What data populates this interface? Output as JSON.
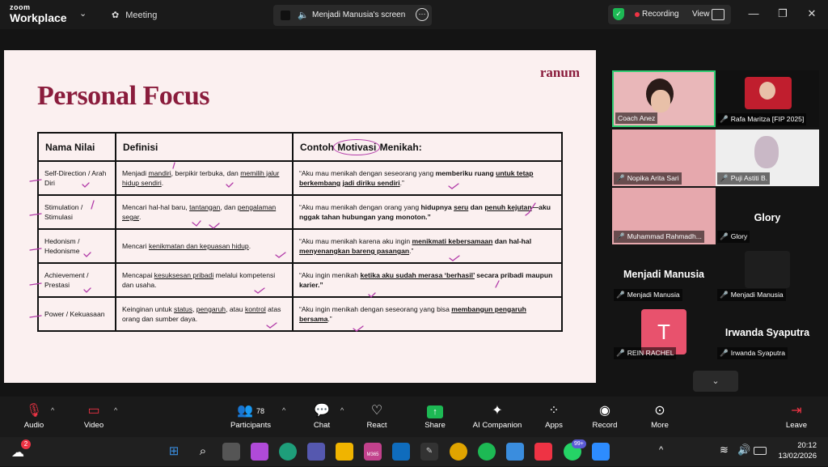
{
  "app": {
    "brand_top": "zoom",
    "brand_main": "Workplace",
    "meeting_label": "Meeting",
    "screen_label": "Menjadi Manusia's screen",
    "recording_label": "Recording",
    "view_label": "View"
  },
  "slide": {
    "logo": "ranum",
    "title": "Personal Focus",
    "headers": [
      "Nama Nilai",
      "Definisi",
      "Contoh ",
      "Motivasi",
      " Menikah:"
    ],
    "rows": [
      {
        "name": "Self-Direction / Arah Diri",
        "def": [
          "Menjadi ",
          "mandiri",
          ", berpikir terbuka, dan ",
          "memilih jalur hidup sendiri",
          "."
        ],
        "ex": [
          "“Aku mau menikah dengan seseorang yang ",
          "memberiku ruang",
          " ",
          "untuk tetap berkembang",
          " ",
          "jadi diriku sendiri",
          ".”"
        ]
      },
      {
        "name": "Stimulation / Stimulasi",
        "def": [
          "Mencari hal-hal baru, ",
          "tantangan",
          ", dan ",
          "pengalaman segar",
          "."
        ],
        "ex": [
          "“Aku mau menikah dengan orang yang ",
          "hidupnya",
          " ",
          "seru",
          " dan ",
          "penuh kejutan",
          "—aku nggak tahan hubungan yang monoton.”"
        ]
      },
      {
        "name": "Hedonism / Hedonisme",
        "def": [
          "Mencari ",
          "kenikmatan dan kepuasan hidup",
          "."
        ],
        "ex": [
          "“Aku mau menikah karena aku ingin ",
          "menikmati kebersamaan",
          " dan hal-hal ",
          "menyenangkan bareng pasangan",
          ".”"
        ]
      },
      {
        "name": "Achievement / Prestasi",
        "def": [
          "Mencapai ",
          "kesuksesan pribadi",
          " melalui kompetensi dan usaha."
        ],
        "ex": [
          "“Aku ingin menikah ",
          "ketika aku sudah merasa ‘berhasil’",
          " secara pribadi maupun karier.”"
        ]
      },
      {
        "name": "Power / Kekuasaan",
        "def": [
          "Keinginan untuk ",
          "status",
          ", ",
          "pengaruh",
          ", atau ",
          "kontrol",
          " atas orang dan sumber daya."
        ],
        "ex": [
          "“Aku ingin menikah dengan seseorang yang bisa ",
          "membangun pengaruh bersama",
          ".”"
        ]
      }
    ]
  },
  "participants": {
    "tiles": [
      {
        "name": "Coach Anez"
      },
      {
        "name": "Rafa Maritza [FIP 2025]"
      },
      {
        "name": "Nopika Arita Sari"
      },
      {
        "name": "Puji Astiti B."
      },
      {
        "name": "Muhammad Rahmadh..."
      },
      {
        "name": "Glory",
        "big": "Glory"
      },
      {
        "name": "Menjadi Manusia",
        "big": "Menjadi Manusia"
      },
      {
        "name": "Menjadi Manusia"
      },
      {
        "name": "REIN RACHEL",
        "avatar": "T"
      },
      {
        "name": "Irwanda Syaputra",
        "big": "Irwanda Syaputra"
      }
    ]
  },
  "toolbar": {
    "audio": "Audio",
    "video": "Video",
    "participants": "Participants",
    "participants_count": "78",
    "chat": "Chat",
    "react": "React",
    "share": "Share",
    "ai": "AI Companion",
    "apps": "Apps",
    "record": "Record",
    "more": "More",
    "leave": "Leave"
  },
  "taskbar": {
    "time": "20:12",
    "date": "13/02/2026",
    "weather_badge": "2",
    "notif_badge": "99+",
    "ms_label": "M365"
  },
  "colors": {
    "accent": "#8a1c3c",
    "annotation": "#b23aa8",
    "recording": "#e34",
    "share": "#1db954"
  }
}
